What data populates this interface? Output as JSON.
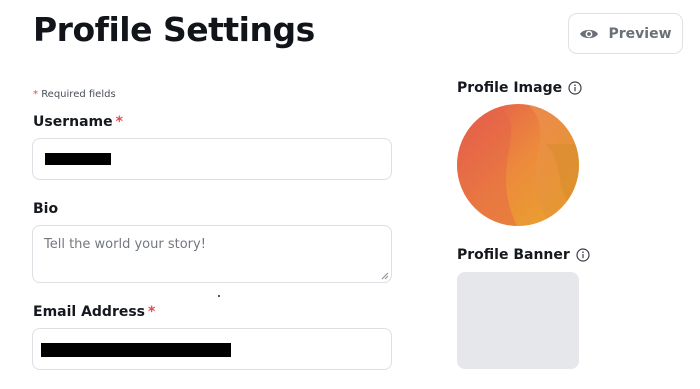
{
  "page": {
    "title": "Profile Settings"
  },
  "header": {
    "preview_label": "Preview",
    "preview_icon": "eye-icon"
  },
  "form": {
    "required_star": "*",
    "required_note": "Required fields",
    "username": {
      "label": "Username",
      "value_redacted": true
    },
    "bio": {
      "label": "Bio",
      "placeholder": "Tell the world your story!"
    },
    "email": {
      "label": "Email Address",
      "value_redacted": true
    }
  },
  "sidebar": {
    "profile_image_label": "Profile Image",
    "profile_banner_label": "Profile Banner",
    "info_icon": "info-icon"
  },
  "colors": {
    "required_star": "#e5484d",
    "avatar_gradient": [
      "#e4544e",
      "#ec8a3c",
      "#e9a62c"
    ],
    "banner_placeholder": "#e6e7ea",
    "border": "#dcdfe4"
  }
}
